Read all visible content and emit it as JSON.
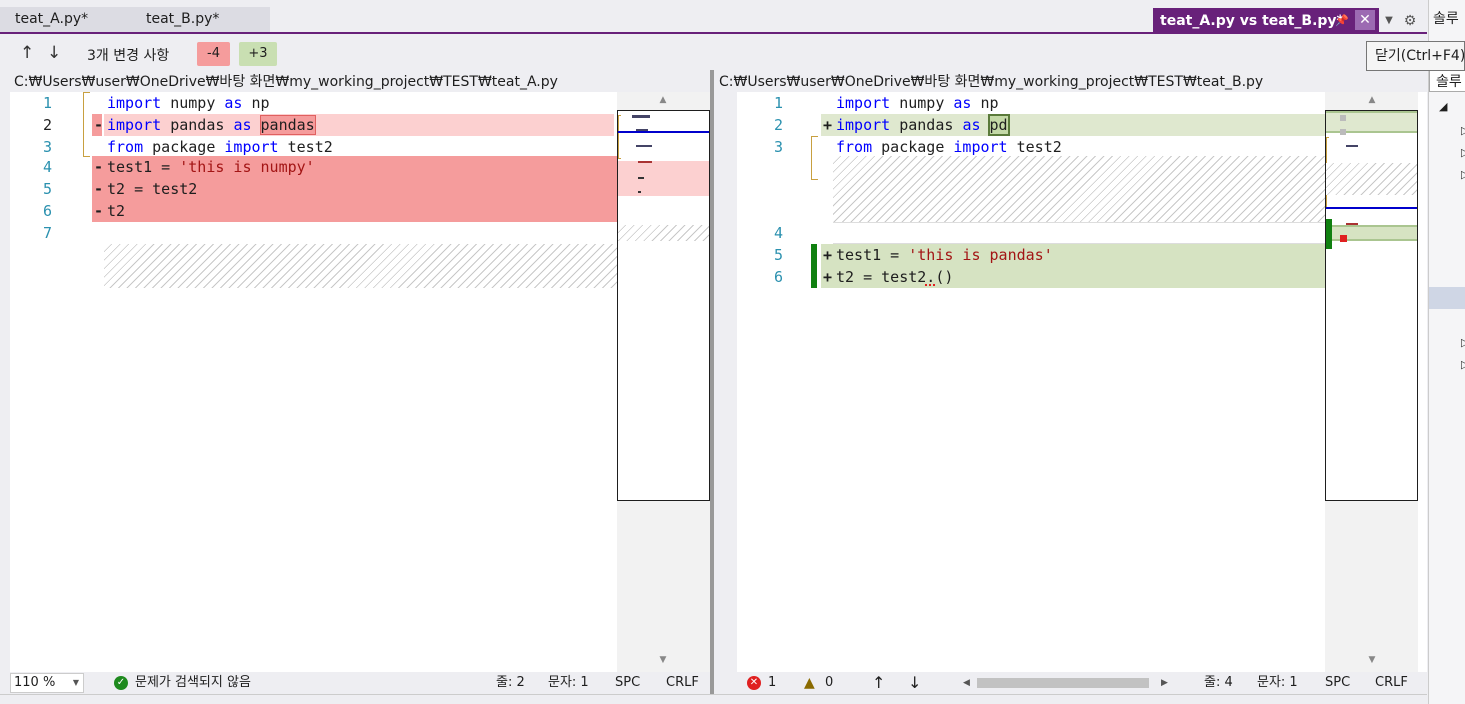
{
  "tabs": {
    "left_file": "teat_A.py*",
    "right_file": "teat_B.py*",
    "active": "teat_A.py vs teat_B.py*",
    "close_tooltip": "닫기(Ctrl+F4)",
    "solution_label": "솔루"
  },
  "toolbar": {
    "up_label": "↑",
    "down_label": "↓",
    "changes": "3개 변경 사항",
    "removed": "-4",
    "added": "+3"
  },
  "left": {
    "path": "C:₩Users₩user₩OneDrive₩바탕 화면₩my_working_project₩TEST₩teat_A.py",
    "line_numbers": [
      "1",
      "2",
      "3",
      "4",
      "5",
      "6",
      "7"
    ],
    "lines": [
      {
        "marker": "",
        "parts": [
          {
            "t": "import",
            "c": "kw"
          },
          {
            "t": " numpy ",
            "c": ""
          },
          {
            "t": "as",
            "c": "kw"
          },
          {
            "t": " np",
            "c": ""
          }
        ]
      },
      {
        "marker": "-",
        "parts": [
          {
            "t": "import",
            "c": "kw"
          },
          {
            "t": " pandas ",
            "c": ""
          },
          {
            "t": "as",
            "c": "kw"
          },
          {
            "t": " ",
            "c": ""
          },
          {
            "t": "pandas",
            "c": "hl"
          }
        ]
      },
      {
        "marker": "",
        "parts": [
          {
            "t": "from",
            "c": "kw"
          },
          {
            "t": " package ",
            "c": ""
          },
          {
            "t": "import",
            "c": "kw"
          },
          {
            "t": " test2",
            "c": ""
          }
        ]
      },
      {
        "marker": "-",
        "parts": [
          {
            "t": "test1 = ",
            "c": ""
          },
          {
            "t": "'this is numpy'",
            "c": "str"
          }
        ]
      },
      {
        "marker": "-",
        "parts": [
          {
            "t": "t2 = test2",
            "c": ""
          }
        ]
      },
      {
        "marker": "-",
        "parts": [
          {
            "t": "t2",
            "c": ""
          }
        ]
      },
      {
        "marker": "",
        "parts": []
      }
    ]
  },
  "right": {
    "path": "C:₩Users₩user₩OneDrive₩바탕 화면₩my_working_project₩TEST₩teat_B.py",
    "line_numbers": [
      "1",
      "2",
      "3",
      "4",
      "5",
      "6"
    ],
    "lines": [
      {
        "marker": "",
        "parts": [
          {
            "t": "import",
            "c": "kw"
          },
          {
            "t": " numpy ",
            "c": ""
          },
          {
            "t": "as",
            "c": "kw"
          },
          {
            "t": " np",
            "c": ""
          }
        ]
      },
      {
        "marker": "+",
        "parts": [
          {
            "t": "import",
            "c": "kw"
          },
          {
            "t": " pandas ",
            "c": ""
          },
          {
            "t": "as",
            "c": "kw"
          },
          {
            "t": " ",
            "c": ""
          },
          {
            "t": "pd",
            "c": "hl"
          }
        ]
      },
      {
        "marker": "",
        "parts": [
          {
            "t": "from",
            "c": "kw"
          },
          {
            "t": " package ",
            "c": ""
          },
          {
            "t": "import",
            "c": "kw"
          },
          {
            "t": " test2",
            "c": ""
          }
        ]
      },
      {
        "marker": "",
        "parts": []
      },
      {
        "marker": "+",
        "parts": [
          {
            "t": "test1 = ",
            "c": ""
          },
          {
            "t": "'this is pandas'",
            "c": "str"
          }
        ]
      },
      {
        "marker": "+",
        "parts": [
          {
            "t": "t2 = test2.()",
            "c": ""
          }
        ]
      }
    ]
  },
  "status_left": {
    "zoom": "110 %",
    "issues": "문제가 검색되지 않음",
    "line": "줄: 2",
    "char": "문자: 1",
    "spc": "SPC",
    "crlf": "CRLF"
  },
  "status_right": {
    "errors": "1",
    "warnings": "0",
    "line": "줄: 4",
    "char": "문자: 1",
    "spc": "SPC",
    "crlf": "CRLF"
  },
  "colors": {
    "accent": "#68217a",
    "removed_bg": "#f59c9c",
    "removed_light": "#fcd0d0",
    "added_bg": "#d6e3c2",
    "added_mark": "#108010"
  }
}
